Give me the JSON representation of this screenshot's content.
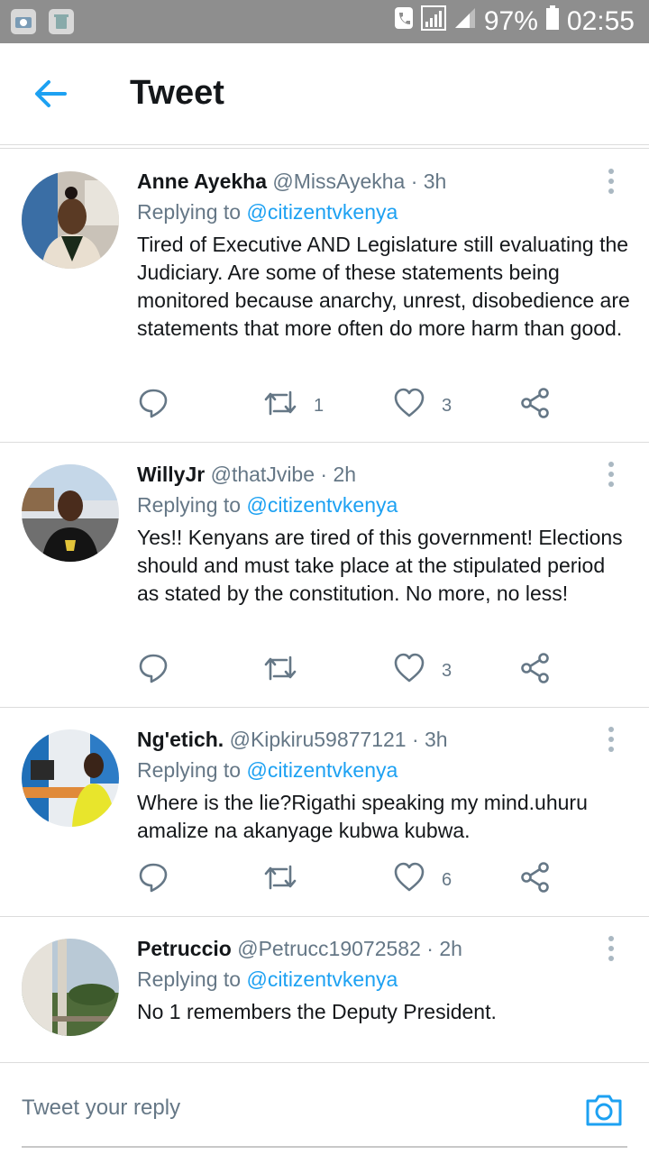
{
  "status_bar": {
    "battery": "97%",
    "time": "02:55"
  },
  "header": {
    "title": "Tweet"
  },
  "tweets": [
    {
      "name": "Anne Ayekha",
      "handle": "@MissAyekha",
      "time": "· 3h",
      "replying_prefix": "Replying to",
      "replying_to": "@citizentvkenya",
      "text": "Tired of Executive AND Legislature still evaluating the Judiciary. Are some of these statements being monitored because anarchy, unrest, disobedience are statements that more often do more harm than good.",
      "retweets": "1",
      "likes": "3"
    },
    {
      "name": "WillyJr",
      "handle": "@thatJvibe",
      "time": "· 2h",
      "replying_prefix": "Replying to",
      "replying_to": "@citizentvkenya",
      "text": "Yes!! Kenyans are tired of this government! Elections should and must take place at the stipulated period as stated by the constitution. No more, no less!",
      "retweets": "",
      "likes": "3"
    },
    {
      "name": "Ng'etich.",
      "handle": "@Kipkiru59877121",
      "time": "· 3h",
      "replying_prefix": "Replying to",
      "replying_to": "@citizentvkenya",
      "text": "Where is the lie?Rigathi speaking my mind.uhuru amalize na akanyage kubwa kubwa.",
      "retweets": "",
      "likes": "6"
    },
    {
      "name": "Petruccio",
      "handle": "@Petrucc19072582",
      "time": "· 2h",
      "replying_prefix": "Replying to",
      "replying_to": "@citizentvkenya",
      "text": "No 1 remembers the Deputy President.",
      "retweets": "",
      "likes": ""
    }
  ],
  "composer": {
    "placeholder": "Tweet your reply"
  },
  "colors": {
    "accent": "#1da1f2",
    "muted": "#657786",
    "status_bar": "#8e8e8e"
  }
}
